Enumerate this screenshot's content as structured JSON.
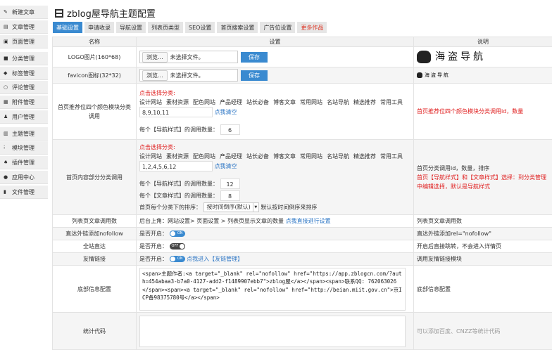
{
  "sidebar": {
    "items": [
      {
        "label": "新建文章",
        "icon": "edit-icon"
      },
      {
        "label": "文章管理",
        "icon": "article-icon"
      },
      {
        "label": "页面管理",
        "icon": "page-icon"
      },
      {
        "label": "分类管理",
        "icon": "folder-icon"
      },
      {
        "label": "标签管理",
        "icon": "tag-icon"
      },
      {
        "label": "评论管理",
        "icon": "comment-icon"
      },
      {
        "label": "附件管理",
        "icon": "attachment-icon"
      },
      {
        "label": "用户管理",
        "icon": "user-icon"
      },
      {
        "label": "主题管理",
        "icon": "theme-icon"
      },
      {
        "label": "模块管理",
        "icon": "module-icon"
      },
      {
        "label": "插件管理",
        "icon": "plugin-icon"
      },
      {
        "label": "应用中心",
        "icon": "app-center-icon"
      },
      {
        "label": "文件管理",
        "icon": "file-icon"
      }
    ]
  },
  "header": {
    "title": "zblog屋导航主题配置"
  },
  "tabs": [
    "基础设置",
    "申请收录",
    "导航设置",
    "列表页类型",
    "SEO设置",
    "首页搜索设置",
    "广告位设置",
    "更多作品"
  ],
  "table": {
    "headers": [
      "名称",
      "设置",
      "说明"
    ],
    "logo": {
      "name": "LOGO图片(160*68)",
      "browse": "浏览...",
      "file": "未选择文件。",
      "save": "保存",
      "logo_text": "海盗导航"
    },
    "favicon": {
      "name": "favicon图标(32*32)",
      "browse": "浏览...",
      "file": "未选择文件。",
      "save": "保存",
      "logo_text": "海盗导航"
    },
    "recommend": {
      "name": "首页推荐位四个颜色模块分类调用",
      "pick": "点击选择分类:",
      "cats": [
        "设计网站",
        "素材资源",
        "配色网站",
        "产品经理",
        "站长必备",
        "博客文章",
        "常用网站",
        "名站导航",
        "精选推荐",
        "常用工具"
      ],
      "value": "8,9,10,11",
      "clear": "点我清空",
      "count_label": "每个【导航样式】的调用数量：",
      "count": "6",
      "desc": "首页推荐位四个颜色模块分类调用id，数量"
    },
    "content": {
      "name": "首页内容部分分类调用",
      "pick": "点击选择分类:",
      "cats": [
        "设计网站",
        "素材资源",
        "配色网站",
        "产品经理",
        "站长必备",
        "博客文章",
        "常用网站",
        "名站导航",
        "精选推荐",
        "常用工具"
      ],
      "value": "1,2,4,5,6,12",
      "clear": "点我清空",
      "nav_label": "每个【导航样式】的调用数量：",
      "nav_count": "12",
      "art_label": "每个【文章样式】的调用数量：",
      "art_count": "8",
      "sort_label": "首页每个分类下的排序：",
      "sort_value": "按时间倒序(默认)",
      "sort_hint": "默认按时间倒序来排序",
      "desc1": "首页分类调用id，数量，排序",
      "desc2": "首页【导航样式】和【文章样式】选择：到分类管理中编辑选择，默认是导航样式"
    },
    "list": {
      "name": "列表页文章调用数",
      "text": "后台上角：网站设置> 页面设置 > 列表页显示文章的数量",
      "link": "点我直接进行设置",
      "desc": "列表页文章调用数"
    },
    "nofollow": {
      "name": "直达外链添加nofollow",
      "label": "是否开启：",
      "toggle": "ON",
      "on": true,
      "desc": "直达外链添加rel=\"nofollow\""
    },
    "allsite": {
      "name": "全站直达",
      "label": "是否开启：",
      "toggle": "OFF",
      "on": false,
      "desc": "开启后直接跳转，不会进入详情页"
    },
    "links": {
      "name": "友情链接",
      "label": "是否开启：",
      "toggle": "ON",
      "on": true,
      "link": "点我进入【友链管理】",
      "desc": "调用友情链接模块"
    },
    "footer": {
      "name": "底部信息配置",
      "value": "<span>主题作者:<a target=\"_blank\" rel=\"nofollow\" href=\"https://app.zblogcn.com/?auth=454abaa3-b7a0-4127-add2-f1489907ebb7\">zblog屋</a></span><span>联系QQ: 762063026</span><span><a target=\"_blank\" rel=\"nofollow\" href=\"http://beian.miit.gov.cn\">京ICP备98375780号</a></span>",
      "desc": "底部信息配置"
    },
    "stats": {
      "name": "统计代码",
      "value": "",
      "desc": "可以添加百度、CNZZ等统计代码"
    }
  },
  "colors": {
    "accent": "#3a8ad0",
    "red": "#e02020"
  }
}
